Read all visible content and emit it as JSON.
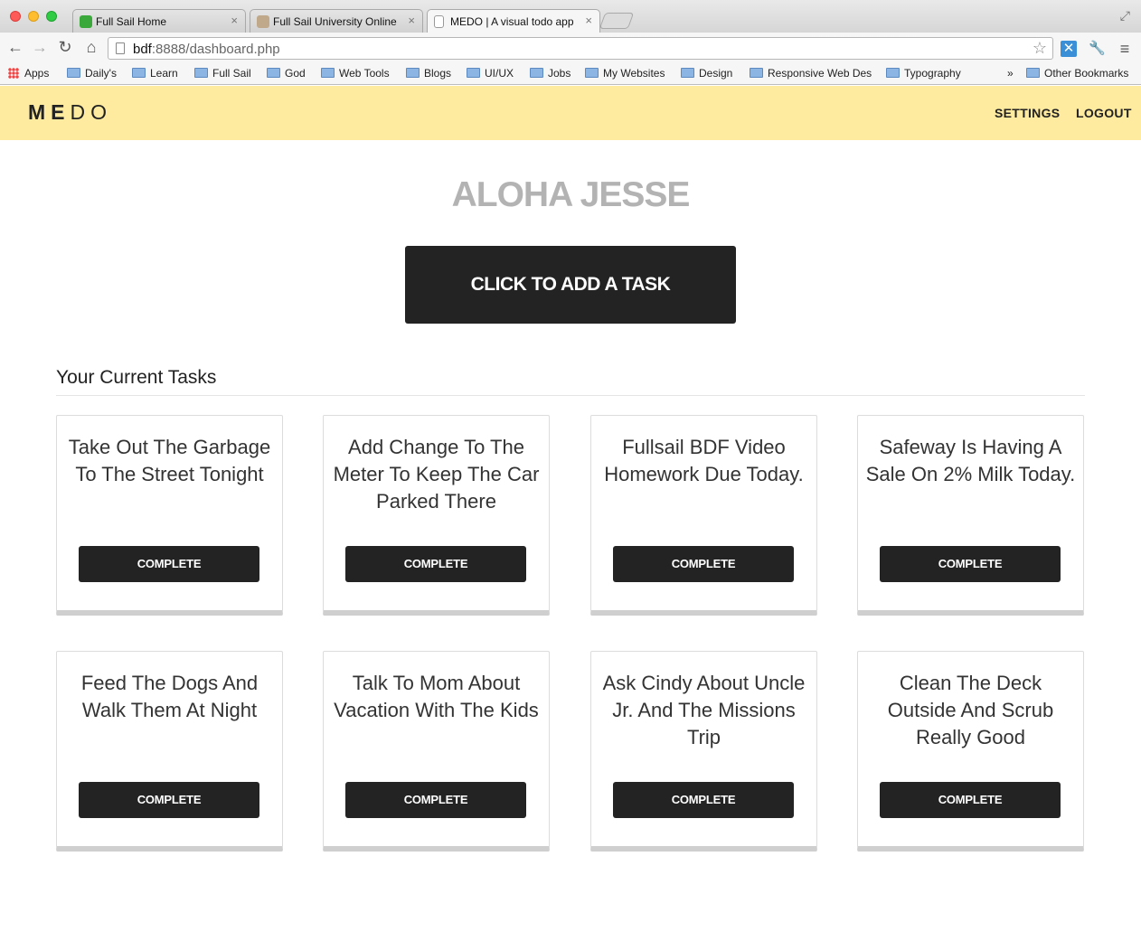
{
  "browser": {
    "tabs": [
      {
        "title": "Full Sail Home",
        "favicon": "fullsail-icon"
      },
      {
        "title": "Full Sail University Online",
        "favicon": "fullsail-online-icon"
      },
      {
        "title": "MEDO | A visual todo app",
        "favicon": "page-icon"
      }
    ],
    "url_host": "bdf",
    "url_rest": ":8888/dashboard.php",
    "bookmarks": [
      "Apps",
      "Daily's",
      "Learn",
      "Full Sail",
      "God",
      "Web Tools",
      "Blogs",
      "UI/UX",
      "Jobs",
      "My Websites",
      "Design",
      "Responsive Web Des",
      "Typography",
      "Other Bookmarks"
    ],
    "bookmarks_overflow": "»"
  },
  "app": {
    "logo_bold": "ME",
    "logo_light": "DO",
    "nav": {
      "settings": "SETTINGS",
      "logout": "LOGOUT"
    },
    "greeting": "ALOHA JESSE",
    "add_task_label": "CLICK TO ADD A TASK",
    "section_title": "Your Current Tasks",
    "complete_label": "COMPLETE",
    "tasks": [
      "Take Out The Garbage To The Street Tonight",
      "Add Change To The Meter To Keep The Car Parked There",
      "Fullsail BDF Video Homework Due Today.",
      "Safeway Is Having A Sale On 2% Milk Today.",
      "Feed The Dogs And Walk Them At Night",
      "Talk To Mom About Vacation With The Kids",
      "Ask Cindy About Uncle Jr. And The Missions Trip",
      "Clean The Deck Outside And Scrub Really Good"
    ],
    "colors": {
      "header_bg": "#ffeba0",
      "button_bg": "#232323",
      "greeting": "#b3b3b3"
    }
  }
}
